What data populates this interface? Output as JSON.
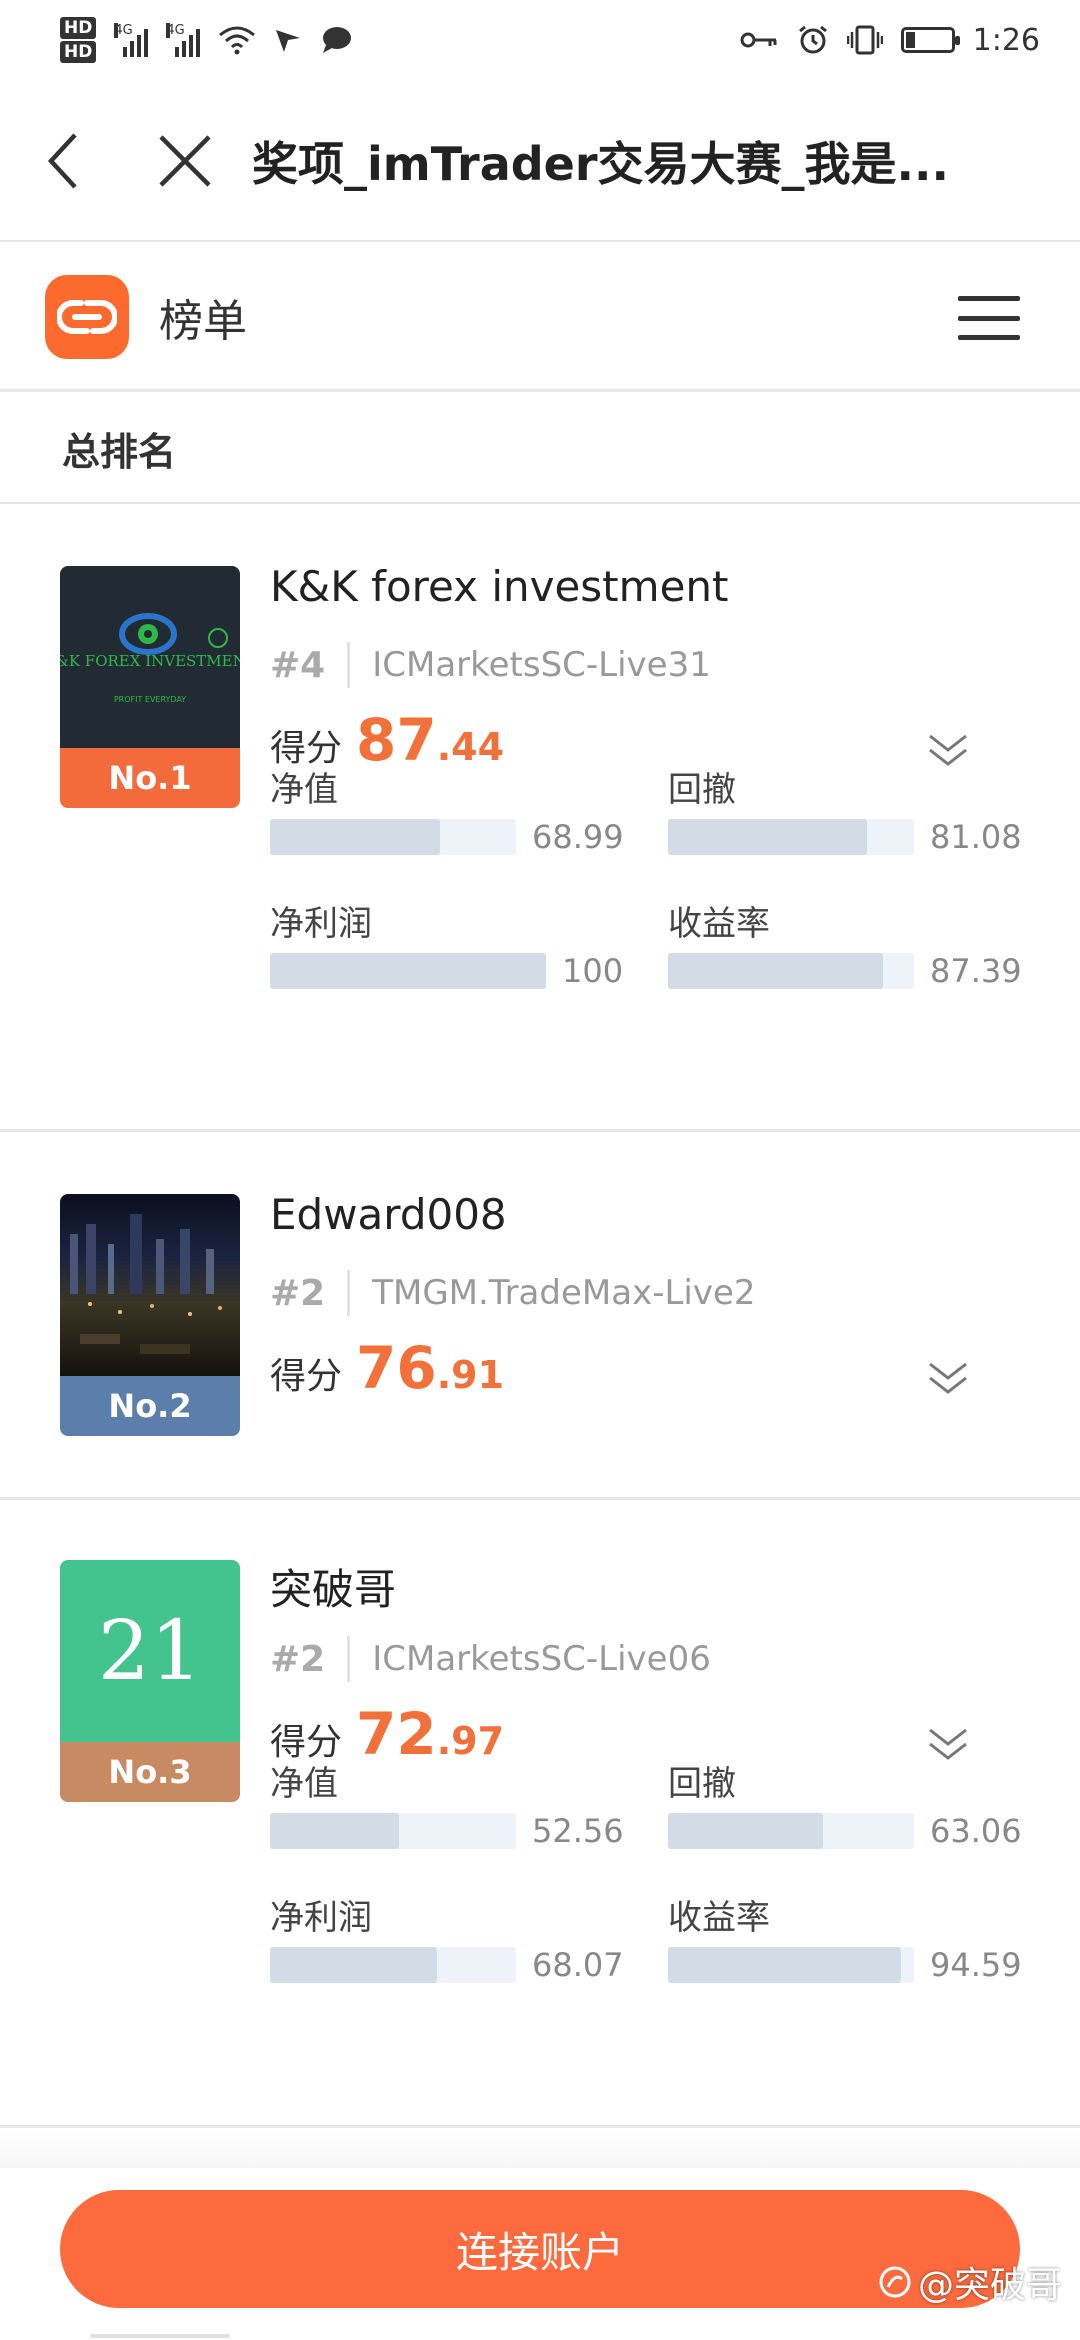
{
  "status_bar": {
    "hd1": "HD",
    "hd2": "HD",
    "net1": "4G",
    "net2": "4G",
    "time": "1:26",
    "battery_level": 0.2,
    "icons": [
      "signal-icon",
      "wifi-icon",
      "location-icon",
      "chat-bubble-icon",
      "key-icon",
      "alarm-icon",
      "vibrate-icon",
      "battery-icon"
    ]
  },
  "titlebar": {
    "title": "奖项_imTrader交易大赛_我是..."
  },
  "header": {
    "title": "榜单"
  },
  "section": {
    "title": "总排名"
  },
  "colors": {
    "accent": "#fd6a3d",
    "score": "#f2703a",
    "rank1": "#f36b3a",
    "rank2": "#5b7eaa",
    "rank3": "#c78a63",
    "avatar3": "#43c48e"
  },
  "entries": [
    {
      "name": "K&K forex investment",
      "rank_label": "No.1",
      "hash": "#4",
      "server": "ICMarketsSC-Live31",
      "score_label": "得分",
      "score_int": "87",
      "score_dec": ".44",
      "logo_text": "K&K FOREX INVESTMENT",
      "logo_sub": "PROFIT EVERYDAY",
      "metrics": [
        {
          "label": "净值",
          "value": "68.99",
          "pct": 68.99
        },
        {
          "label": "回撤",
          "value": "81.08",
          "pct": 81.08
        },
        {
          "label": "净利润",
          "value": "100",
          "pct": 100
        },
        {
          "label": "收益率",
          "value": "87.39",
          "pct": 87.39
        }
      ]
    },
    {
      "name": "Edward008",
      "rank_label": "No.2",
      "hash": "#2",
      "server": "TMGM.TradeMax-Live2",
      "score_label": "得分",
      "score_int": "76",
      "score_dec": ".91",
      "metrics": []
    },
    {
      "name": "突破哥",
      "rank_label": "No.3",
      "hash": "#2",
      "server": "ICMarketsSC-Live06",
      "score_label": "得分",
      "score_int": "72",
      "score_dec": ".97",
      "avatar_text": "21",
      "metrics": [
        {
          "label": "净值",
          "value": "52.56",
          "pct": 52.56
        },
        {
          "label": "回撤",
          "value": "63.06",
          "pct": 63.06
        },
        {
          "label": "净利润",
          "value": "68.07",
          "pct": 68.07
        },
        {
          "label": "收益率",
          "value": "94.59",
          "pct": 94.59
        }
      ]
    }
  ],
  "bottom": {
    "connect_label": "连接账户",
    "watermark": "@突破哥"
  }
}
